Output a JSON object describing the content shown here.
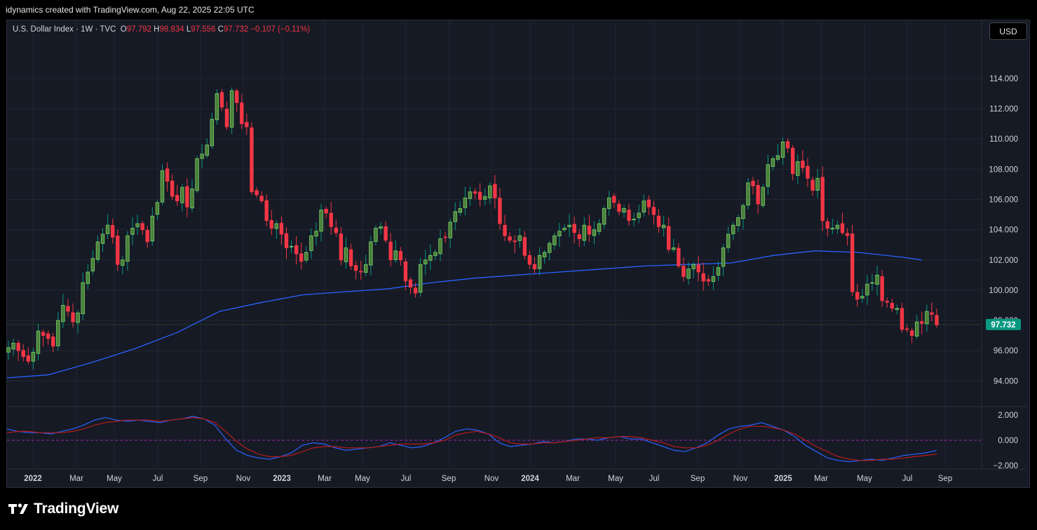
{
  "header": {
    "caption": "idynamics created with TradingView.com, Aug 22, 2025 22:05 UTC"
  },
  "legend": {
    "symbol": "U.S. Dollar Index · 1W · TVC",
    "o_label": "O",
    "o_value": "97.792",
    "h_label": "H",
    "h_value": "98.834",
    "l_label": "L",
    "l_value": "97.556",
    "c_label": "C",
    "c_value": "97.732",
    "change": "−0.107 (−0.11%)"
  },
  "currency_button": "USD",
  "footer": {
    "brand": "TradingView"
  },
  "colors": {
    "up": "#089981",
    "down": "#f23645",
    "ma": "#2962ff",
    "osc_fast": "#2962ff",
    "osc_slow": "#b71c1c",
    "background": "#161a25",
    "grid": "#232734"
  },
  "chart_data": [
    {
      "type": "candlestick",
      "interval": "1W",
      "x_tick_labels": [
        "2022",
        "Mar",
        "May",
        "Jul",
        "Sep",
        "Nov",
        "2023",
        "Mar",
        "May",
        "Jul",
        "Sep",
        "Nov",
        "2024",
        "Mar",
        "May",
        "Jul",
        "Sep",
        "Nov",
        "2025",
        "Mar",
        "May",
        "Jul",
        "Sep"
      ],
      "y_tick_labels": [
        "114.000",
        "112.000",
        "110.000",
        "108.000",
        "106.000",
        "104.000",
        "102.000",
        "100.000",
        "98.000",
        "96.000",
        "94.000"
      ],
      "ylim": [
        92.3,
        116.5
      ],
      "last_price_label": "97.732",
      "close_series": [
        96.2,
        96.5,
        96.0,
        95.6,
        95.3,
        95.9,
        97.3,
        97.0,
        96.8,
        96.3,
        98.0,
        99.0,
        98.6,
        97.9,
        98.5,
        100.5,
        101.2,
        102.1,
        103.2,
        103.7,
        104.3,
        103.5,
        101.7,
        102.0,
        103.6,
        104.1,
        104.4,
        104.0,
        103.2,
        104.9,
        105.8,
        107.9,
        107.2,
        106.2,
        105.9,
        106.8,
        105.5,
        106.7,
        108.7,
        109.0,
        109.6,
        111.3,
        113.0,
        112.1,
        110.8,
        113.2,
        112.4,
        111.0,
        110.8,
        106.5,
        106.3,
        105.9,
        104.6,
        104.1,
        104.4,
        103.7,
        102.8,
        102.9,
        102.4,
        101.9,
        102.5,
        103.6,
        103.9,
        105.3,
        105.1,
        104.2,
        103.8,
        102.0,
        102.8,
        101.6,
        101.3,
        101.2,
        101.7,
        103.2,
        104.1,
        104.2,
        103.3,
        102.0,
        102.6,
        102.0,
        100.6,
        100.2,
        99.8,
        101.7,
        102.0,
        102.3,
        102.5,
        103.4,
        103.5,
        104.5,
        105.2,
        105.4,
        106.1,
        106.5,
        106.4,
        106.0,
        106.2,
        106.9,
        106.1,
        104.4,
        103.6,
        103.3,
        103.2,
        103.6,
        102.3,
        101.7,
        101.4,
        102.3,
        102.5,
        103.1,
        103.6,
        103.9,
        104.1,
        104.3,
        103.8,
        103.4,
        104.3,
        103.7,
        104.0,
        104.4,
        105.4,
        106.1,
        105.8,
        105.2,
        105.4,
        104.6,
        104.7,
        105.1,
        105.9,
        105.5,
        105.0,
        104.2,
        104.3,
        102.7,
        102.8,
        101.6,
        100.9,
        101.4,
        101.7,
        101.2,
        100.6,
        100.6,
        100.9,
        101.5,
        102.8,
        103.7,
        104.3,
        104.8,
        105.6,
        107.1,
        106.9,
        105.7,
        106.8,
        108.3,
        108.7,
        108.9,
        109.8,
        109.4,
        107.7,
        108.5,
        108.1,
        107.4,
        106.6,
        107.4,
        104.6,
        104.1,
        104.1,
        104.3,
        103.8,
        103.6,
        99.9,
        99.4,
        99.6,
        100.4,
        100.5,
        101.0,
        99.3,
        99.2,
        98.8,
        98.8,
        97.4,
        97.4,
        97.0,
        97.9,
        97.8,
        98.6,
        98.4,
        97.7
      ],
      "ma_series": [
        {
          "date": "2022-01",
          "value": 94.2
        },
        {
          "date": "2022-03",
          "value": 94.4
        },
        {
          "date": "2022-05",
          "value": 95.2
        },
        {
          "date": "2022-07",
          "value": 96.1
        },
        {
          "date": "2022-09",
          "value": 97.2
        },
        {
          "date": "2022-11",
          "value": 98.6
        },
        {
          "date": "2023-01",
          "value": 99.2
        },
        {
          "date": "2023-03",
          "value": 99.7
        },
        {
          "date": "2023-05",
          "value": 99.9
        },
        {
          "date": "2023-07",
          "value": 100.1
        },
        {
          "date": "2023-09",
          "value": 100.5
        },
        {
          "date": "2023-11",
          "value": 100.8
        },
        {
          "date": "2024-01",
          "value": 101.0
        },
        {
          "date": "2024-03",
          "value": 101.2
        },
        {
          "date": "2024-05",
          "value": 101.4
        },
        {
          "date": "2024-07",
          "value": 101.6
        },
        {
          "date": "2024-09",
          "value": 101.7
        },
        {
          "date": "2024-11",
          "value": 101.8
        },
        {
          "date": "2025-01",
          "value": 102.3
        },
        {
          "date": "2025-03",
          "value": 102.6
        },
        {
          "date": "2025-05",
          "value": 102.5
        },
        {
          "date": "2025-07",
          "value": 102.2
        },
        {
          "date": "2025-08",
          "value": 102.0
        }
      ]
    },
    {
      "type": "line",
      "y_tick_labels": [
        "2.000",
        "0.000",
        "−2.000"
      ],
      "ylim": [
        -2.0,
        2.0
      ],
      "zero_line": true,
      "series": [
        {
          "values": [
            0.9,
            0.7,
            0.6,
            0.6,
            0.5,
            0.7,
            0.9,
            1.2,
            1.6,
            1.8,
            1.6,
            1.5,
            1.6,
            1.5,
            1.4,
            1.6,
            1.7,
            1.9,
            1.7,
            1.2,
            0.1,
            -0.8,
            -1.2,
            -1.4,
            -1.5,
            -1.3,
            -1.0,
            -0.4,
            -0.2,
            -0.3,
            -0.6,
            -0.8,
            -0.7,
            -0.6,
            -0.5,
            -0.2,
            -0.4,
            -0.6,
            -0.5,
            -0.2,
            0.2,
            0.7,
            0.9,
            0.8,
            0.5,
            -0.2,
            -0.5,
            -0.4,
            -0.3,
            -0.1,
            -0.2,
            -0.1,
            0.1,
            0.1,
            0.0,
            0.2,
            0.3,
            0.1,
            0.1,
            -0.2,
            -0.5,
            -0.8,
            -0.9,
            -0.6,
            -0.2,
            0.4,
            0.9,
            1.1,
            1.2,
            1.4,
            1.1,
            0.8,
            0.3,
            -0.4,
            -0.9,
            -1.4,
            -1.6,
            -1.7,
            -1.6,
            -1.5,
            -1.6,
            -1.4,
            -1.2,
            -1.1,
            -1.0,
            -0.8
          ]
        },
        {
          "values": [
            0.6,
            0.7,
            0.7,
            0.6,
            0.6,
            0.6,
            0.7,
            0.9,
            1.2,
            1.4,
            1.5,
            1.6,
            1.6,
            1.6,
            1.5,
            1.6,
            1.7,
            1.8,
            1.7,
            1.4,
            0.7,
            -0.1,
            -0.7,
            -1.1,
            -1.3,
            -1.3,
            -1.2,
            -0.9,
            -0.6,
            -0.5,
            -0.5,
            -0.6,
            -0.6,
            -0.6,
            -0.5,
            -0.4,
            -0.3,
            -0.3,
            -0.3,
            -0.2,
            0.0,
            0.4,
            0.6,
            0.7,
            0.5,
            0.2,
            -0.2,
            -0.3,
            -0.3,
            -0.2,
            -0.2,
            -0.1,
            0.0,
            0.1,
            0.2,
            0.2,
            0.3,
            0.3,
            0.2,
            0.0,
            -0.2,
            -0.5,
            -0.6,
            -0.6,
            -0.4,
            0.0,
            0.5,
            0.9,
            1.1,
            1.1,
            1.0,
            0.8,
            0.5,
            0.0,
            -0.5,
            -0.9,
            -1.3,
            -1.5,
            -1.6,
            -1.6,
            -1.5,
            -1.5,
            -1.4,
            -1.3,
            -1.2,
            -1.1
          ]
        }
      ]
    }
  ]
}
